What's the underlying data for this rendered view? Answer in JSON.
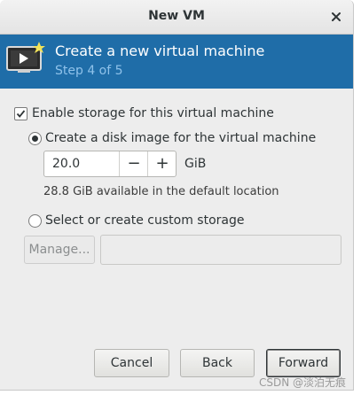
{
  "dialog": {
    "title": "New VM"
  },
  "header": {
    "title": "Create a new virtual machine",
    "step": "Step 4 of 5"
  },
  "storage": {
    "enable_label": "Enable storage for this virtual machine",
    "enable_checked": true,
    "create_disk_label": "Create a disk image for the virtual machine",
    "create_disk_selected": true,
    "disk_size": "20.0",
    "decrement_glyph": "−",
    "increment_glyph": "+",
    "unit": "GiB",
    "available": "28.8 GiB available in the default location",
    "custom_label": "Select or create custom storage",
    "custom_selected": false,
    "manage_label": "Manage...",
    "custom_path": ""
  },
  "buttons": {
    "cancel": "Cancel",
    "back": "Back",
    "forward": "Forward"
  },
  "icons": {
    "close": "close-icon",
    "vm": "monitor-icon",
    "check": "checkmark-icon"
  },
  "colors": {
    "header_bg": "#1f6da8",
    "header_sub": "#8fc2ea",
    "dialog_bg": "#ededed"
  },
  "watermark": "CSDN @淡泊无痕"
}
